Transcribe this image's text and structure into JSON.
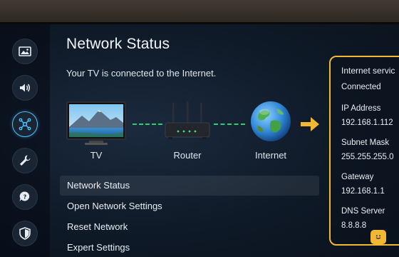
{
  "page": {
    "title": "Network Status",
    "subtitle": "Your TV is connected to the Internet."
  },
  "sidebar": {
    "items": [
      {
        "icon": "picture-icon"
      },
      {
        "icon": "sound-icon"
      },
      {
        "icon": "network-icon",
        "active": true
      },
      {
        "icon": "wrench-icon"
      },
      {
        "icon": "support-icon"
      },
      {
        "icon": "shield-icon"
      }
    ]
  },
  "diagram": {
    "tv_label": "TV",
    "router_label": "Router",
    "internet_label": "Internet",
    "link_color": "#2fd06a",
    "arrow_color": "#f2b733"
  },
  "menu": [
    {
      "label": "Network Status",
      "selected": true
    },
    {
      "label": "Open Network Settings"
    },
    {
      "label": "Reset Network"
    },
    {
      "label": "Expert Settings"
    }
  ],
  "info": {
    "service_label": "Internet servic",
    "service_value": "Connected",
    "ip_label": "IP Address",
    "ip_value": "192.168.1.112",
    "subnet_label": "Subnet Mask",
    "subnet_value": "255.255.255.0",
    "gateway_label": "Gateway",
    "gateway_value": "192.168.1.1",
    "dns_label": "DNS Server",
    "dns_value": "8.8.8.8"
  },
  "colors": {
    "accent": "#4ec1ff",
    "highlight_border": "#f2b733",
    "connection": "#2fd06a"
  }
}
